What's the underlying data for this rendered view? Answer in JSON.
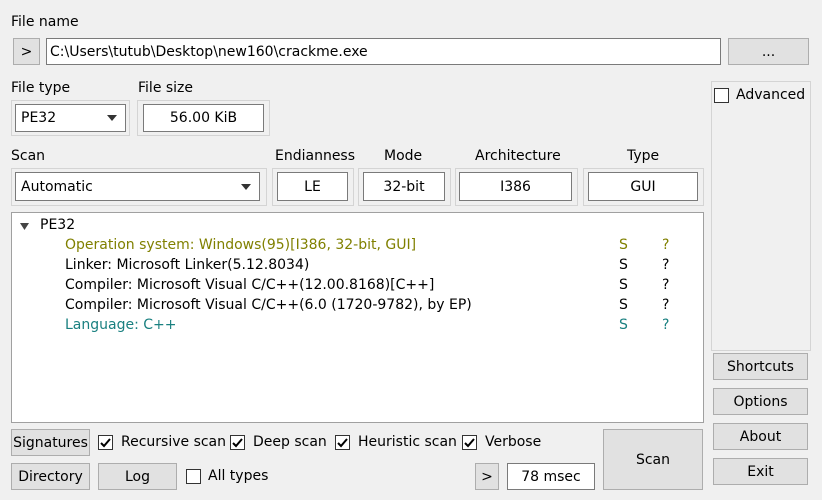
{
  "file_name": {
    "label": "File name",
    "expand_button": ">",
    "path": "C:\\Users\\tutub\\Desktop\\new160\\crackme.exe",
    "browse_button": "..."
  },
  "file_type": {
    "label": "File type",
    "value": "PE32"
  },
  "file_size": {
    "label": "File size",
    "value": "56.00 KiB"
  },
  "advanced": {
    "label": "Advanced",
    "checked": false
  },
  "scan": {
    "label": "Scan",
    "value": "Automatic"
  },
  "endianness": {
    "label": "Endianness",
    "value": "LE"
  },
  "mode": {
    "label": "Mode",
    "value": "32-bit"
  },
  "architecture": {
    "label": "Architecture",
    "value": "I386"
  },
  "type": {
    "label": "Type",
    "value": "GUI"
  },
  "results": {
    "root": "PE32",
    "rows": [
      {
        "text": "Operation system: Windows(95)[I386, 32-bit, GUI]",
        "s": "S",
        "q": "?",
        "color": "#808000"
      },
      {
        "text": "Linker: Microsoft Linker(5.12.8034)",
        "s": "S",
        "q": "?",
        "color": "#000000"
      },
      {
        "text": "Compiler: Microsoft Visual C/C++(12.00.8168)[C++]",
        "s": "S",
        "q": "?",
        "color": "#000000"
      },
      {
        "text": "Compiler: Microsoft Visual C/C++(6.0 (1720-9782), by EP)",
        "s": "S",
        "q": "?",
        "color": "#000000"
      },
      {
        "text": "Language: C++",
        "s": "S",
        "q": "?",
        "color": "#1a8080"
      }
    ]
  },
  "bottom": {
    "signatures": "Signatures",
    "recursive_scan": "Recursive scan",
    "deep_scan": "Deep scan",
    "heuristic_scan": "Heuristic scan",
    "verbose": "Verbose",
    "directory": "Directory",
    "log": "Log",
    "all_types": "All types",
    "time_expand": ">",
    "time": "78 msec",
    "scan_button": "Scan"
  },
  "side": {
    "shortcuts": "Shortcuts",
    "options": "Options",
    "about": "About",
    "exit": "Exit"
  },
  "colors": {
    "background": "#f0f0f0",
    "button": "#e1e1e1",
    "os_row": "#808000",
    "language_row": "#1a8080"
  },
  "icons": {
    "checkmark": "checkmark-icon",
    "expand": "tree-expand-icon",
    "dropdown": "chevron-down-icon"
  }
}
